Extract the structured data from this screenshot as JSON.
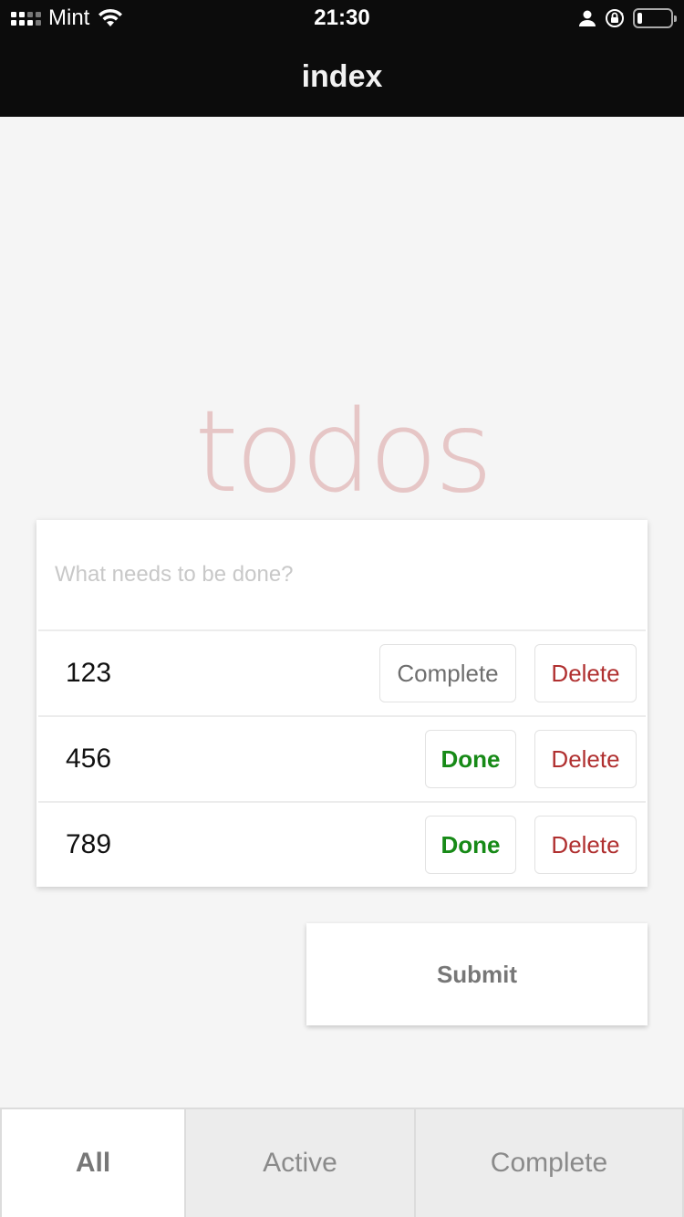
{
  "status_bar": {
    "carrier": "Mint",
    "time": "21:30",
    "battery_level": 0.15
  },
  "nav": {
    "title": "index"
  },
  "app": {
    "title": "todos",
    "title_color": "#e6c6c6"
  },
  "new_todo": {
    "placeholder": "What needs to be done?",
    "value": ""
  },
  "todos": [
    {
      "text": "123",
      "action_label": "Complete",
      "delete_label": "Delete"
    },
    {
      "text": "456",
      "action_label": "Done",
      "delete_label": "Delete"
    },
    {
      "text": "789",
      "action_label": "Done",
      "delete_label": "Delete"
    }
  ],
  "submit": {
    "label": "Submit"
  },
  "tabs": [
    {
      "label": "All",
      "selected": true
    },
    {
      "label": "Active",
      "selected": false
    },
    {
      "label": "Complete",
      "selected": false
    }
  ],
  "colors": {
    "done": "#178a17",
    "delete": "#b03030",
    "navbar": "#0c0c0c",
    "background": "#f5f5f5"
  }
}
